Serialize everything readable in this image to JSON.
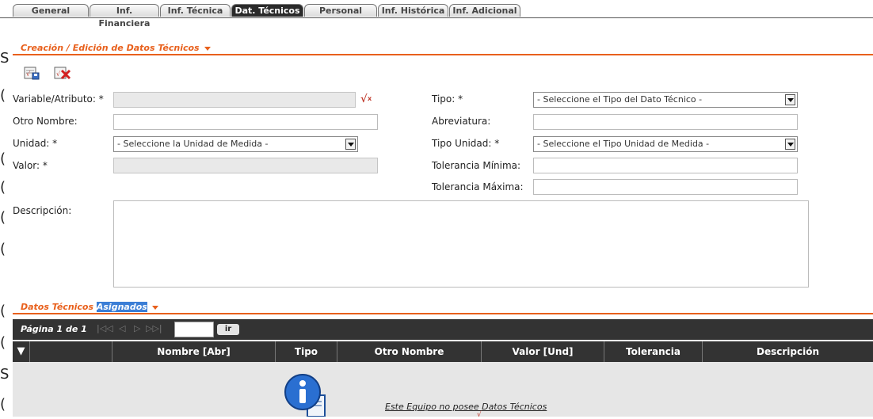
{
  "tabs": [
    {
      "label": "General",
      "active": false
    },
    {
      "label": "Inf. Financiera",
      "active": false
    },
    {
      "label": "Inf. Técnica",
      "active": false
    },
    {
      "label": "Dat. Técnicos",
      "active": true
    },
    {
      "label": "Personal",
      "active": false
    },
    {
      "label": "Inf. Histórica",
      "active": false
    },
    {
      "label": "Inf. Adicional",
      "active": false
    }
  ],
  "form_section": {
    "title": "Creación / Edición de Datos Técnicos"
  },
  "toolbar": {
    "save_icon": "save-icon",
    "delete_icon": "delete-icon"
  },
  "form": {
    "variable_label": "Variable/Atributo: *",
    "otro_nombre_label": "Otro Nombre:",
    "unidad_label": "Unidad: *",
    "unidad_value": "- Seleccione la Unidad de Medida -",
    "valor_label": "Valor: *",
    "tipo_label": "Tipo: *",
    "tipo_value": "- Seleccione el Tipo del Dato Técnico -",
    "abreviatura_label": "Abreviatura:",
    "tipo_unidad_label": "Tipo Unidad: *",
    "tipo_unidad_value": "- Seleccione el Tipo Unidad de Medida -",
    "tol_min_label": "Tolerancia Mínima:",
    "tol_max_label": "Tolerancia Máxima:",
    "descripcion_label": "Descripción:"
  },
  "list_section": {
    "title_a": "Datos Técnicos ",
    "title_b": "Asignados"
  },
  "pager": {
    "text": "Página 1 de 1",
    "go_label": "ir",
    "page_value": ""
  },
  "table": {
    "columns": [
      "Nombre [Abr]",
      "Tipo",
      "Otro Nombre",
      "Valor [Und]",
      "Tolerancia",
      "Descripción"
    ],
    "empty_message": "Este Equipo no posee Datos Técnicos"
  },
  "left_cut_letters": [
    "S",
    "(",
    "(",
    "(",
    "(",
    "(",
    "(",
    "(",
    "S",
    "("
  ]
}
